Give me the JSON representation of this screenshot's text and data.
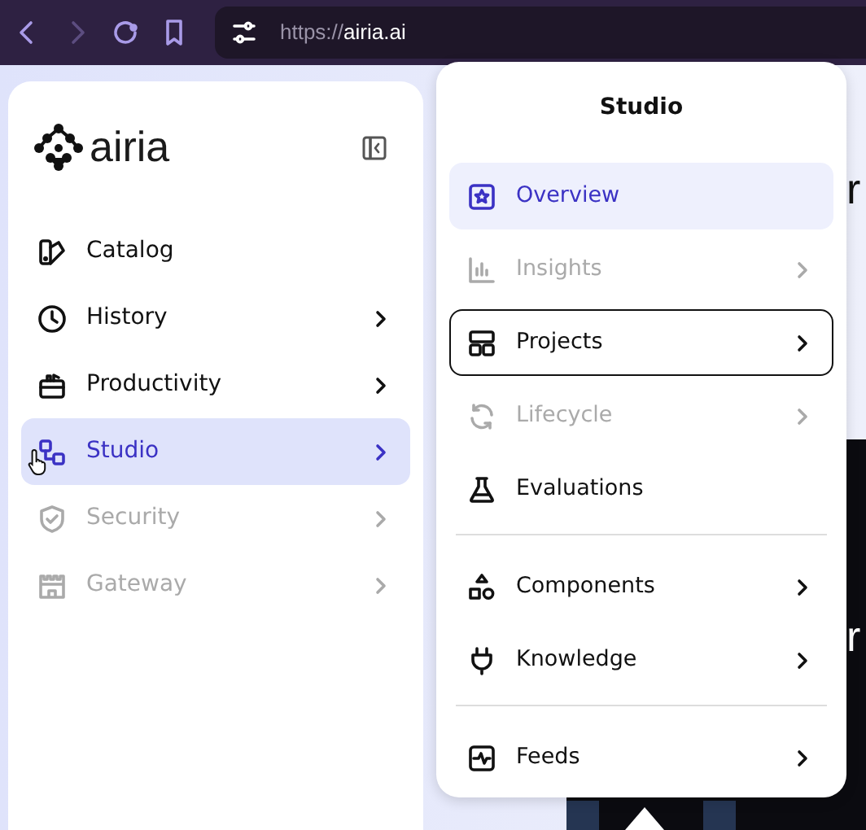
{
  "browser": {
    "url_scheme": "https://",
    "url_host": "airia.ai"
  },
  "sidebar": {
    "logo": "airia",
    "items": [
      {
        "label": "Catalog",
        "submenu": false,
        "selected": false,
        "disabled": false
      },
      {
        "label": "History",
        "submenu": true,
        "selected": false,
        "disabled": false
      },
      {
        "label": "Productivity",
        "submenu": true,
        "selected": false,
        "disabled": false
      },
      {
        "label": "Studio",
        "submenu": true,
        "selected": true,
        "disabled": false
      },
      {
        "label": "Security",
        "submenu": true,
        "selected": false,
        "disabled": true
      },
      {
        "label": "Gateway",
        "submenu": true,
        "selected": false,
        "disabled": true
      }
    ]
  },
  "menu": {
    "title": "Studio",
    "items": [
      {
        "kind": "item",
        "label": "Overview",
        "submenu": false,
        "selected": true,
        "disabled": false,
        "focused": false
      },
      {
        "kind": "item",
        "label": "Insights",
        "submenu": true,
        "selected": false,
        "disabled": true,
        "focused": false
      },
      {
        "kind": "item",
        "label": "Projects",
        "submenu": true,
        "selected": false,
        "disabled": false,
        "focused": true
      },
      {
        "kind": "item",
        "label": "Lifecycle",
        "submenu": true,
        "selected": false,
        "disabled": true,
        "focused": false
      },
      {
        "kind": "item",
        "label": "Evaluations",
        "submenu": false,
        "selected": false,
        "disabled": false,
        "focused": false
      },
      {
        "kind": "divider"
      },
      {
        "kind": "item",
        "label": "Components",
        "submenu": true,
        "selected": false,
        "disabled": false,
        "focused": false
      },
      {
        "kind": "item",
        "label": "Knowledge",
        "submenu": true,
        "selected": false,
        "disabled": false,
        "focused": false
      },
      {
        "kind": "divider"
      },
      {
        "kind": "item",
        "label": "Feeds",
        "submenu": true,
        "selected": false,
        "disabled": false,
        "focused": false
      }
    ]
  },
  "background_text": [
    "r",
    "r"
  ]
}
